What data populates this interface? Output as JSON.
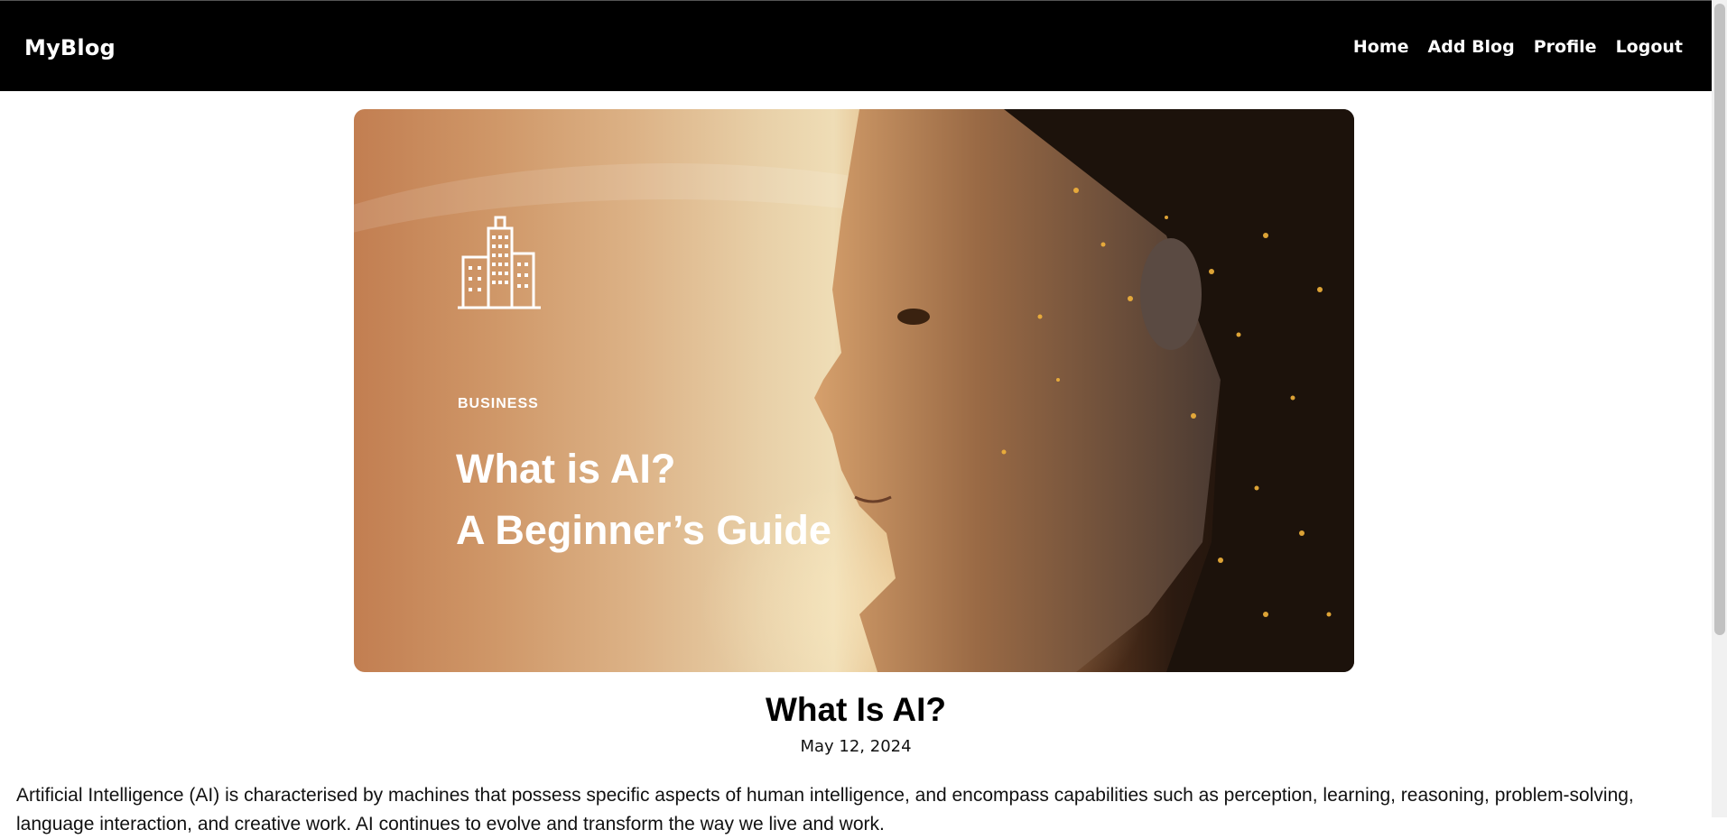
{
  "navbar": {
    "brand": "MyBlog",
    "links": [
      "Home",
      "Add Blog",
      "Profile",
      "Logout"
    ]
  },
  "hero": {
    "category": "BUSINESS",
    "title_line1": "What is AI?",
    "title_line2": "A Beginner’s Guide",
    "icon": "building-icon"
  },
  "post": {
    "title": "What Is AI?",
    "date": "May 12, 2024",
    "body": "Artificial Intelligence (AI) is characterised by machines that possess specific aspects of human intelligence, and encompass capabilities such as perception, learning, reasoning, problem-solving, language interaction, and creative work. AI continues to evolve and transform the way we live and work."
  },
  "colors": {
    "navbar_bg": "#000000",
    "hero_accent": "#c27e51"
  }
}
